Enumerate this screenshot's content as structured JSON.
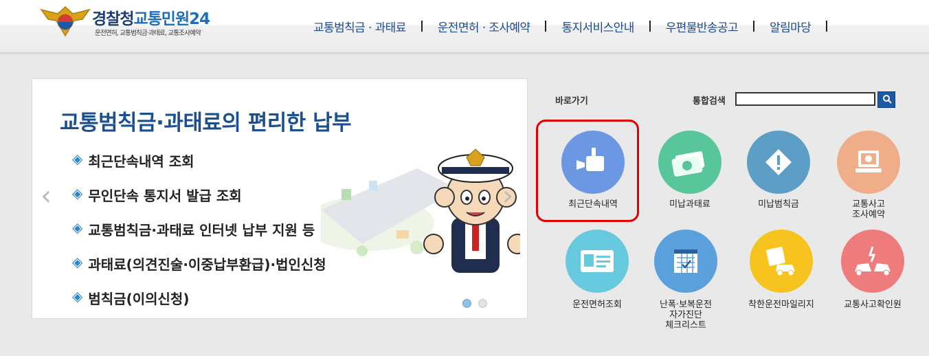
{
  "header": {
    "logo": {
      "title_main": "경찰청",
      "title_accent": "교통민원24",
      "subtitle": "운전면허, 교통범칙금·과태료, 교통조사예약"
    },
    "nav": [
      {
        "label": "교통범칙금 · 과태료"
      },
      {
        "label": "운전면허 · 조사예약"
      },
      {
        "label": "통지서비스안내"
      },
      {
        "label": "우편물반송공고"
      },
      {
        "label": "알림마당"
      }
    ]
  },
  "banner": {
    "title": "교통범칙금·과태료의 편리한 납부",
    "items": [
      "최근단속내역 조회",
      "무인단속 통지서 발급 조회",
      "교통범칙금·과태료 인터넷 납부 지원 등",
      "과태료(의견진술·이중납부환급)·법인신청",
      "범칙금(이의신청)"
    ],
    "bullet": "◈",
    "prev_glyph": "‹",
    "next_glyph": "›",
    "slides": {
      "current": 1,
      "total": 2
    }
  },
  "quick": {
    "label": "바로가기",
    "search_label": "통합검색",
    "search_value": "",
    "tiles": [
      {
        "label": "최근단속내역",
        "icon": "cctv-camera-icon",
        "color": "#6b97e3",
        "highlighted": true
      },
      {
        "label": "미납과태료",
        "icon": "money-bill-icon",
        "color": "#59c59a"
      },
      {
        "label": "미납범칙금",
        "icon": "warning-diamond-icon",
        "color": "#5d9ec6"
      },
      {
        "label": "교통사고\n조사예약",
        "icon": "computer-monitor-icon",
        "color": "#f0ad8a"
      },
      {
        "label": "운전면허조회",
        "icon": "id-card-icon",
        "color": "#67c9dd"
      },
      {
        "label": "난폭·보복운전\n자가진단\n체크리스트",
        "icon": "calendar-checklist-icon",
        "color": "#5aa0dc"
      },
      {
        "label": "착한운전마일리지",
        "icon": "mileage-car-icon",
        "color": "#f7c31e"
      },
      {
        "label": "교통사고확인원",
        "icon": "car-crash-icon",
        "color": "#ef7c7c"
      }
    ]
  },
  "colors": {
    "nav_text": "#1e4b8c",
    "banner_title": "#1c4f8f",
    "bullet": "#2b86c7",
    "highlight_border": "#e00000",
    "search_button": "#1b58a7"
  }
}
